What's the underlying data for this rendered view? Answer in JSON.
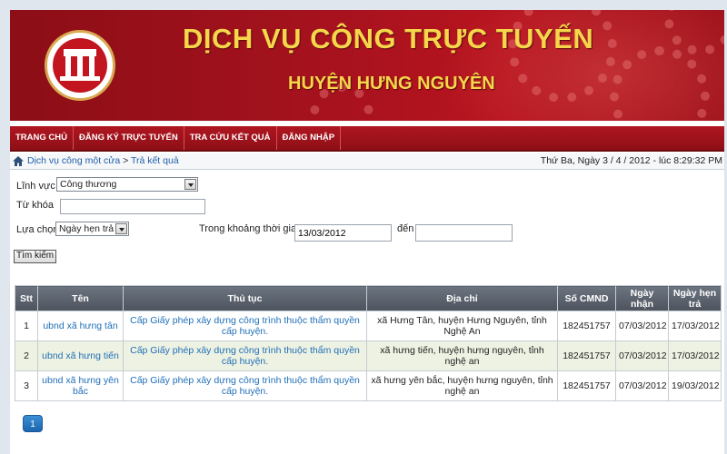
{
  "header": {
    "title": "DỊCH VỤ CÔNG TRỰC TUYẾN",
    "subtitle": "HUYỆN HƯNG NGUYÊN"
  },
  "nav": {
    "items": [
      "TRANG CHỦ",
      "ĐĂNG KÝ TRỰC TUYẾN",
      "TRA CỨU KẾT QUẢ",
      "ĐĂNG NHẬP"
    ]
  },
  "breadcrumb": {
    "root": "Dịch vụ công một cửa",
    "separator": " > ",
    "current": "Trả kết quả"
  },
  "datetime": "Thứ Ba, Ngày 3 / 4 / 2012 - lúc 8:29:32 PM",
  "form": {
    "field_label": "Lĩnh vực",
    "field_value": "Công thương",
    "keyword_label": "Từ khóa",
    "keyword_value": "",
    "option_label": "Lựa chọn",
    "option_value": "Ngày hẹn trả",
    "period_label": "Trong khoảng thời gian",
    "from_value": "13/03/2012",
    "to_label": "đến",
    "to_value": "",
    "search_button": "Tìm kiếm"
  },
  "table": {
    "headers": [
      "Stt",
      "Tên",
      "Thủ tục",
      "Địa chỉ",
      "Số CMND",
      "Ngày nhận",
      "Ngày hẹn trả"
    ],
    "rows": [
      {
        "stt": "1",
        "name": "ubnd xã hưng tân",
        "procedure": "Cấp Giấy phép xây dựng công trình thuộc thẩm quyền cấp huyện.",
        "address": "xã Hưng Tân, huyện Hưng Nguyên, tỉnh Nghệ An",
        "id_number": "182451757",
        "received": "07/03/2012",
        "due": "17/03/2012"
      },
      {
        "stt": "2",
        "name": "ubnd xã hưng tiến",
        "procedure": "Cấp Giấy phép xây dựng công trình thuộc thẩm quyền cấp huyện.",
        "address": "xã hưng tiến, huyện hưng nguyên, tỉnh nghệ an",
        "id_number": "182451757",
        "received": "07/03/2012",
        "due": "17/03/2012"
      },
      {
        "stt": "3",
        "name": "ubnd xã hưng yên bắc",
        "procedure": "Cấp Giấy phép xây dựng công trình thuộc thẩm quyền cấp huyện.",
        "address": "xã hưng yên bắc, huyện hưng nguyên, tỉnh nghệ an",
        "id_number": "182451757",
        "received": "07/03/2012",
        "due": "19/03/2012"
      }
    ]
  },
  "pagination": {
    "current": "1"
  },
  "colors": {
    "banner": "#a3121d",
    "title_gold": "#f6d64a",
    "header_gray": "#555c66",
    "link_blue": "#1f6fb8",
    "pager_blue": "#1b65ad"
  },
  "icons": [
    "home-icon",
    "chevron-down-icon",
    "emblem-logo"
  ]
}
